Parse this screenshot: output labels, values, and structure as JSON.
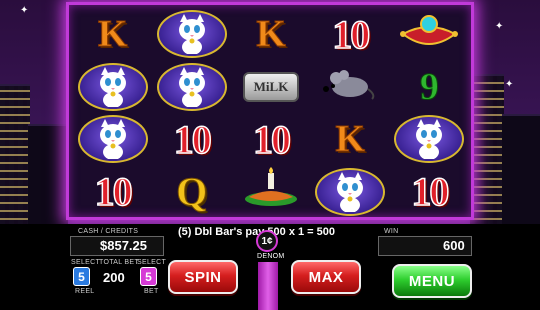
{
  "reels": [
    [
      "K",
      "cat",
      "K",
      "10",
      "pillow"
    ],
    [
      "cat",
      "cat",
      "milk",
      "mouse",
      "9"
    ],
    [
      "cat",
      "10",
      "10",
      "K",
      "cat"
    ],
    [
      "10",
      "Q",
      "fish",
      "cat",
      "10"
    ]
  ],
  "milk_label": "MiLK",
  "message": "(5) Dbl Bar's pay 500 x 1 = 500",
  "denomination": "1¢",
  "denomination_label": "DENOM",
  "cash_label": "CASH / CREDITS",
  "cash_value": "$857.25",
  "win_label": "WIN",
  "win_value": "600",
  "select_label": "SELECT",
  "reel_select_value": "5",
  "reel_label": "REEL",
  "total_bet_label": "TOTAL BET",
  "total_bet_value": "200",
  "bet_select_value": "5",
  "bet_label": "BET",
  "buttons": {
    "spin": "SPIN",
    "max": "MAX",
    "menu": "MENU"
  },
  "colors": {
    "frame": "#c13ad9",
    "reel_select": "#2a7ae0",
    "bet_select": "#d63ad6"
  }
}
